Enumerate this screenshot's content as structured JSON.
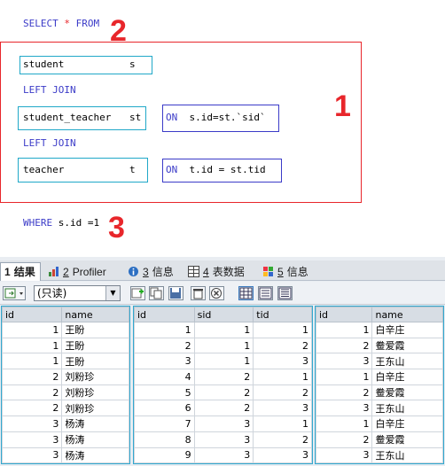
{
  "sql": {
    "select_kw": "SELECT",
    "star": "*",
    "from_kw": "FROM",
    "table1": "student",
    "alias1": "s",
    "join1": "LEFT JOIN",
    "table2": "student_teacher",
    "alias2": "st",
    "on_kw": "ON",
    "cond1": "s.id=st.`sid`",
    "join2": "LEFT JOIN",
    "table3": "teacher",
    "alias3": "t",
    "on_kw2": "ON",
    "cond2": "t.id = st.tid",
    "where_kw": "WHERE",
    "where_cond": "s.id =1"
  },
  "annotations": {
    "n1": "1",
    "n2": "2",
    "n3": "3"
  },
  "colors": {
    "annotation_red": "#e8262b",
    "keyword_blue": "#3b3bc8",
    "box_teal": "#20a8c8"
  },
  "tabs": [
    {
      "num": "1",
      "label": "结果",
      "icon": "grid-icon"
    },
    {
      "num": "2",
      "label": "Profiler",
      "icon": "profiler-icon"
    },
    {
      "num": "3",
      "label": "信息",
      "icon": "info-icon"
    },
    {
      "num": "4",
      "label": "表数据",
      "icon": "table-icon"
    },
    {
      "num": "5",
      "label": "信息",
      "icon": "info-icon"
    }
  ],
  "toolbar": {
    "readonly": "(只读)"
  },
  "results": {
    "student": {
      "headers": [
        "id",
        "name"
      ],
      "rows": [
        [
          "1",
          "王盼"
        ],
        [
          "1",
          "王盼"
        ],
        [
          "1",
          "王盼"
        ],
        [
          "2",
          "刘粉珍"
        ],
        [
          "2",
          "刘粉珍"
        ],
        [
          "2",
          "刘粉珍"
        ],
        [
          "3",
          "杨涛"
        ],
        [
          "3",
          "杨涛"
        ],
        [
          "3",
          "杨涛"
        ]
      ]
    },
    "student_teacher": {
      "headers": [
        "id",
        "sid",
        "tid"
      ],
      "rows": [
        [
          "1",
          "1",
          "1"
        ],
        [
          "2",
          "1",
          "2"
        ],
        [
          "3",
          "1",
          "3"
        ],
        [
          "4",
          "2",
          "1"
        ],
        [
          "5",
          "2",
          "2"
        ],
        [
          "6",
          "2",
          "3"
        ],
        [
          "7",
          "3",
          "1"
        ],
        [
          "8",
          "3",
          "2"
        ],
        [
          "9",
          "3",
          "3"
        ]
      ]
    },
    "teacher": {
      "headers": [
        "id",
        "name"
      ],
      "rows": [
        [
          "1",
          "白辛庄"
        ],
        [
          "2",
          "鲞爱霞"
        ],
        [
          "3",
          "王东山"
        ],
        [
          "1",
          "白辛庄"
        ],
        [
          "2",
          "鲞爱霞"
        ],
        [
          "3",
          "王东山"
        ],
        [
          "1",
          "白辛庄"
        ],
        [
          "2",
          "鲞爱霞"
        ],
        [
          "3",
          "王东山"
        ]
      ]
    }
  }
}
